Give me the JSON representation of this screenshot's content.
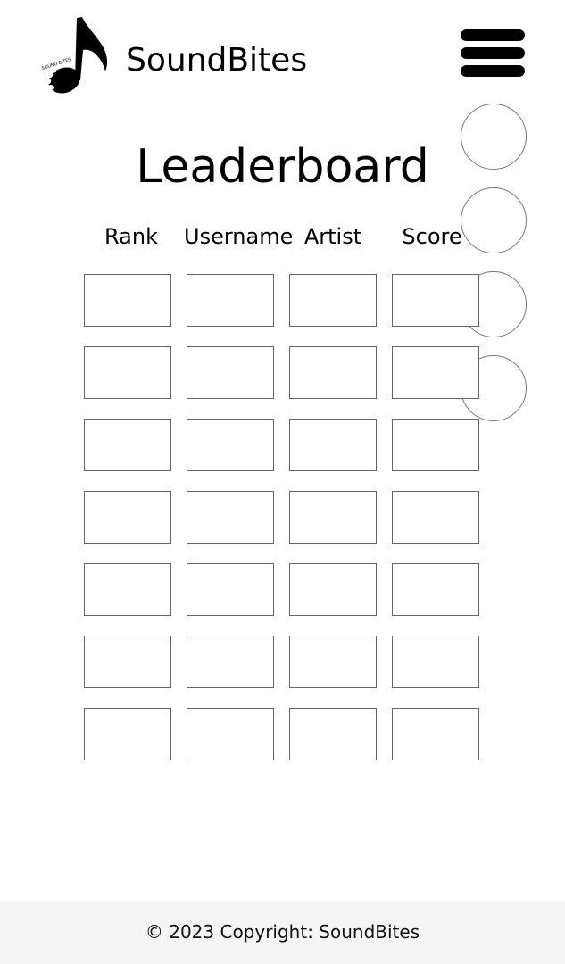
{
  "brand": {
    "name": "SoundBites",
    "logo_icon": "music-note-icon",
    "logo_text": "SOUND BITES"
  },
  "header": {
    "menu_icon": "hamburger-menu-icon"
  },
  "side_buttons": [
    {
      "name": "circle-button-1"
    },
    {
      "name": "circle-button-2"
    },
    {
      "name": "circle-button-3"
    },
    {
      "name": "circle-button-4"
    }
  ],
  "leaderboard": {
    "title": "Leaderboard",
    "columns": [
      "Rank",
      "Username",
      "Artist",
      "Score"
    ],
    "rows": [
      [
        "",
        "",
        "",
        ""
      ],
      [
        "",
        "",
        "",
        ""
      ],
      [
        "",
        "",
        "",
        ""
      ],
      [
        "",
        "",
        "",
        ""
      ],
      [
        "",
        "",
        "",
        ""
      ],
      [
        "",
        "",
        "",
        ""
      ],
      [
        "",
        "",
        "",
        ""
      ]
    ]
  },
  "footer": {
    "text": "© 2023 Copyright: SoundBites"
  }
}
